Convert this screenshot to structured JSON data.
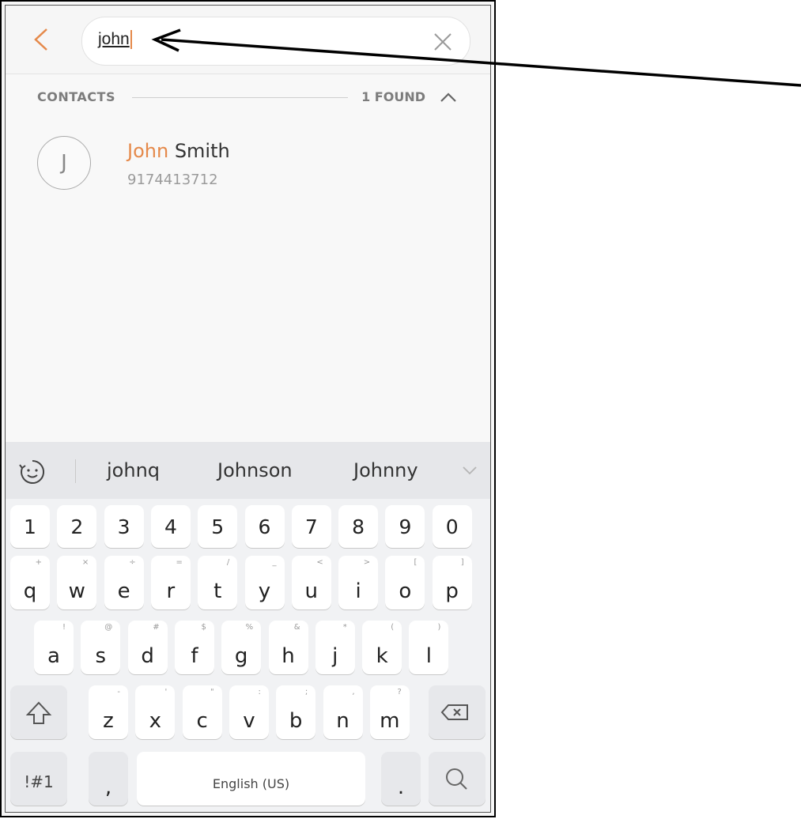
{
  "search": {
    "query": "john",
    "back_icon": "chevron-left-icon",
    "clear_icon": "close-icon"
  },
  "contacts": {
    "section_label": "CONTACTS",
    "found_label": "1 FOUND",
    "collapse_icon": "chevron-up-icon",
    "results": [
      {
        "initial": "J",
        "name_highlight": "John",
        "name_rest": " Smith",
        "phone": "9174413712"
      }
    ]
  },
  "keyboard": {
    "suggestions": [
      "johnq",
      "Johnson",
      "Johnny"
    ],
    "emoji_icon": "emoji-icon",
    "more_icon": "chevron-down-icon",
    "number_row": [
      "1",
      "2",
      "3",
      "4",
      "5",
      "6",
      "7",
      "8",
      "9",
      "0"
    ],
    "row1": {
      "keys": [
        "q",
        "w",
        "e",
        "r",
        "t",
        "y",
        "u",
        "i",
        "o",
        "p"
      ],
      "subs": [
        "+",
        "×",
        "÷",
        "=",
        "/",
        "_",
        "<",
        ">",
        "[",
        "]"
      ]
    },
    "row2": {
      "keys": [
        "a",
        "s",
        "d",
        "f",
        "g",
        "h",
        "j",
        "k",
        "l"
      ],
      "subs": [
        "!",
        "@",
        "#",
        "$",
        "%",
        "&",
        "*",
        "(",
        ")"
      ]
    },
    "row3": {
      "keys": [
        "z",
        "x",
        "c",
        "v",
        "b",
        "n",
        "m"
      ],
      "subs": [
        "-",
        "'",
        "\"",
        ":",
        ";",
        ",",
        "?"
      ]
    },
    "shift_icon": "shift-icon",
    "backspace_icon": "backspace-icon",
    "symbols_label": "!#1",
    "comma_label": ",",
    "space_label": "English (US)",
    "period_label": ".",
    "search_key_icon": "search-icon"
  },
  "colors": {
    "accent": "#e5894a",
    "keyboard_bg": "#f1f2f4",
    "key_bg": "#ffffff"
  }
}
